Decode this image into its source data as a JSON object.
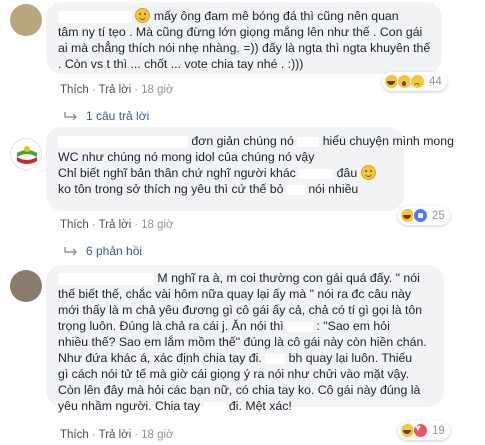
{
  "comments": [
    {
      "lines": [
        "mấy ông đam mê bóng đá thì cũng nên quan",
        "tâm ny tí tẹo . Mà cũng đừng lớn giọng mắng lên như thế . Con gái",
        "ai mà chẳng thích nói nhẹ nhàng. =)) đấy là ngta thì ngta khuyên thế",
        ". Còn vs t thì ... chốt ... vote chia tay nhé . :)))"
      ],
      "reactions": [
        "haha",
        "wow",
        "sad"
      ],
      "reaction_count": "44",
      "like": "Thích",
      "reply": "Trả lời",
      "time": "18 giờ",
      "replies_link": "1 câu trả lời"
    },
    {
      "lines": [
        "đơn giản chúng nó",
        "hiểu chuyện mình mong",
        "WC như chúng nó mong idol của chúng nó vậy",
        "Chỉ biết nghĩ bản thân chứ nghĩ người khác",
        "đâu",
        "ko tôn trong sở thích ng yêu thì cứ thế bỏ",
        "nói nhiều"
      ],
      "reactions": [
        "haha",
        "like"
      ],
      "reaction_count": "25",
      "like": "Thích",
      "reply": "Trả lời",
      "time": "18 giờ",
      "replies_link": "6 phản hồi"
    },
    {
      "lines": [
        "M nghĩ ra à, m coi thường con gái quá đấy. \" nói",
        "thế biết thế, chắc vài hôm nữa quay lại ấy mà \" nói ra đc câu này",
        "mới thấy là m chả yêu đương gì cô gái ấy cả, chả có tí gì gọi là tôn",
        "trọng luôn. Đúng là chả ra cái j. Ăn nói thì",
        ": \"Sao em hỏi",
        "nhiều thế? Sao em lắm mồm thế\" đúng là cô gái này còn hiền chán.",
        "Như đứa khác á, xác định chia tay đi.",
        "bh quay lại luôn. Thiếu",
        "gì cách nói tử tế mà giờ cái giọng ý ra nói như chửi vào mặt vậy.",
        "Còn lên đây mà hỏi các bạn nữ, có chia tay ko. Cô gái này đúng là",
        "yêu nhầm người. Chia tay",
        "đi. Mệt xác!"
      ],
      "reactions": [
        "haha",
        "love"
      ],
      "reaction_count": "19",
      "like": "Thích",
      "reply": "Trả lời",
      "time": "18 giờ"
    }
  ]
}
